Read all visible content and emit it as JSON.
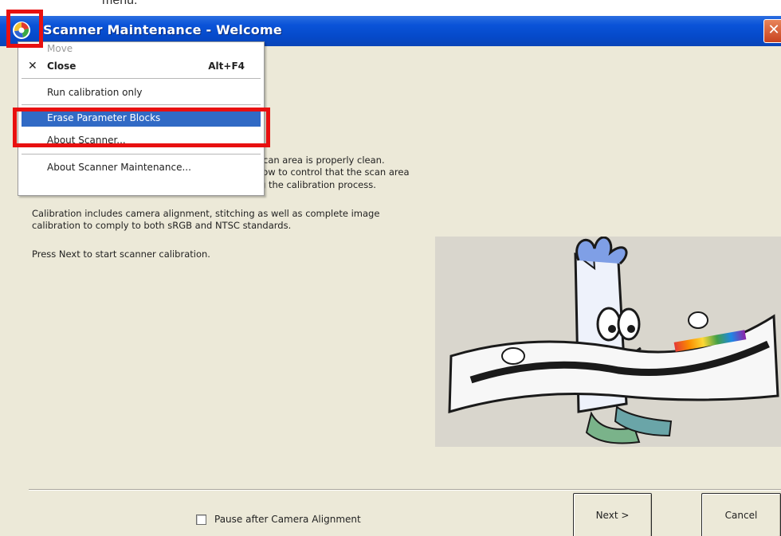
{
  "document_fragment": "menu.",
  "window": {
    "title": "Scanner Maintenance - Welcome",
    "close_glyph": "✕"
  },
  "menu": {
    "items": [
      {
        "label": "Move",
        "shortcut": "",
        "icon": ""
      },
      {
        "label": "Close",
        "shortcut": "Alt+F4",
        "icon": "close-icon"
      },
      {
        "label": "Run calibration only",
        "shortcut": "",
        "icon": ""
      },
      {
        "label": "Erase Parameter Blocks",
        "shortcut": "",
        "icon": "",
        "highlighted": true
      },
      {
        "label": "About Scanner...",
        "shortcut": "",
        "icon": ""
      },
      {
        "label": "About Scanner Maintenance...",
        "shortcut": "",
        "icon": ""
      }
    ]
  },
  "content": {
    "para1_line1": "scan area is properly clean.",
    "para1_line2": "low to control that the scan area",
    "para1_line3": "g the calibration process.",
    "para2_line1": "Calibration includes camera alignment, stitching as well as complete image",
    "para2_line2": "calibration to comply to both sRGB and NTSC standards.",
    "para3": "Press Next to start scanner calibration."
  },
  "footer": {
    "checkbox_label": "Pause after Camera Alignment",
    "checkbox_checked": false,
    "next_label": "Next >",
    "cancel_label": "Cancel"
  },
  "colors": {
    "titlebar": "#0a53d8",
    "highlight": "#316ac5",
    "annotation": "#e81010",
    "dialog_bg": "#ece9d8"
  }
}
